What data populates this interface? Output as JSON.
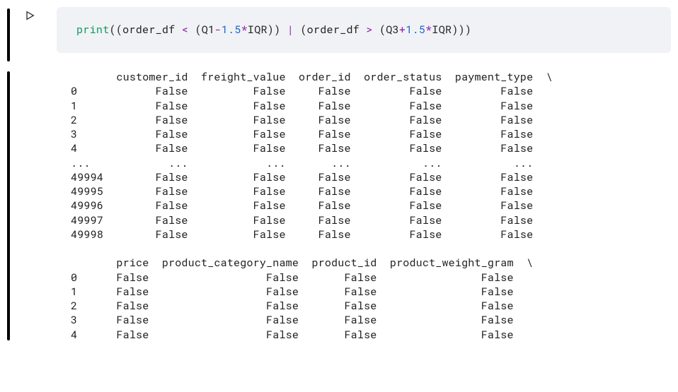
{
  "code": {
    "tokens": [
      {
        "t": "print",
        "c": "built-in"
      },
      {
        "t": "((order_df ",
        "c": "default"
      },
      {
        "t": "<",
        "c": "operator"
      },
      {
        "t": " (Q1",
        "c": "default"
      },
      {
        "t": "-",
        "c": "operator"
      },
      {
        "t": "1.5",
        "c": "number"
      },
      {
        "t": "*",
        "c": "operator"
      },
      {
        "t": "IQR)) ",
        "c": "default"
      },
      {
        "t": "|",
        "c": "operator"
      },
      {
        "t": " (order_df ",
        "c": "default"
      },
      {
        "t": ">",
        "c": "operator"
      },
      {
        "t": " (Q3",
        "c": "default"
      },
      {
        "t": "+",
        "c": "operator"
      },
      {
        "t": "1.5",
        "c": "number"
      },
      {
        "t": "*",
        "c": "operator"
      },
      {
        "t": "IQR)))",
        "c": "default"
      }
    ]
  },
  "output": {
    "block1": {
      "header": "       customer_id  freight_value  order_id  order_status  payment_type  \\",
      "rows": [
        {
          "idx": "0    ",
          "v": [
            "False",
            "False",
            "False",
            "False",
            "False"
          ]
        },
        {
          "idx": "1    ",
          "v": [
            "False",
            "False",
            "False",
            "False",
            "False"
          ]
        },
        {
          "idx": "2    ",
          "v": [
            "False",
            "False",
            "False",
            "False",
            "False"
          ]
        },
        {
          "idx": "3    ",
          "v": [
            "False",
            "False",
            "False",
            "False",
            "False"
          ]
        },
        {
          "idx": "4    ",
          "v": [
            "False",
            "False",
            "False",
            "False",
            "False"
          ]
        },
        {
          "idx": "...  ",
          "v": [
            "  ...",
            "  ...",
            "  ...",
            "  ...",
            "  ..."
          ]
        },
        {
          "idx": "49994",
          "v": [
            "False",
            "False",
            "False",
            "False",
            "False"
          ]
        },
        {
          "idx": "49995",
          "v": [
            "False",
            "False",
            "False",
            "False",
            "False"
          ]
        },
        {
          "idx": "49996",
          "v": [
            "False",
            "False",
            "False",
            "False",
            "False"
          ]
        },
        {
          "idx": "49997",
          "v": [
            "False",
            "False",
            "False",
            "False",
            "False"
          ]
        },
        {
          "idx": "49998",
          "v": [
            "False",
            "False",
            "False",
            "False",
            "False"
          ]
        }
      ],
      "widths": [
        11,
        13,
        8,
        12,
        12
      ]
    },
    "block2": {
      "header": "       price  product_category_name  product_id  product_weight_gram  \\",
      "rows": [
        {
          "idx": "0    ",
          "v": [
            "False",
            "False",
            "False",
            "False"
          ]
        },
        {
          "idx": "1    ",
          "v": [
            "False",
            "False",
            "False",
            "False"
          ]
        },
        {
          "idx": "2    ",
          "v": [
            "False",
            "False",
            "False",
            "False"
          ]
        },
        {
          "idx": "3    ",
          "v": [
            "False",
            "False",
            "False",
            "False"
          ]
        },
        {
          "idx": "4    ",
          "v": [
            "False",
            "False",
            "False",
            "False"
          ]
        }
      ],
      "widths": [
        5,
        21,
        10,
        19
      ]
    }
  }
}
